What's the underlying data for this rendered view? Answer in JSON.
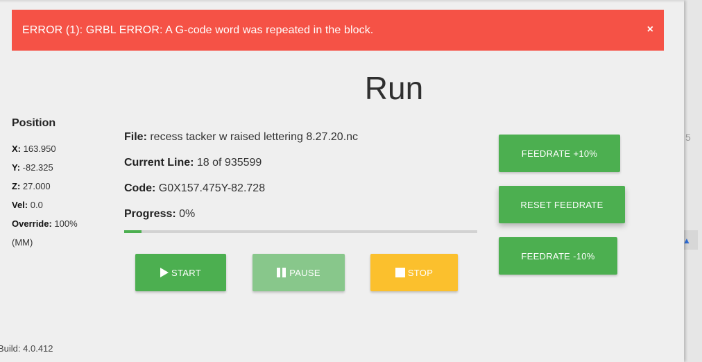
{
  "alert": {
    "message": "ERROR (1): GRBL ERROR: A G-code word was repeated in the block.",
    "close": "×",
    "color": "#f55246"
  },
  "page_title": "Run",
  "position": {
    "title": "Position",
    "x_label": "X:",
    "x_value": " 163.950",
    "y_label": "Y:",
    "y_value": " -82.325",
    "z_label": "Z:",
    "z_value": " 27.000",
    "vel_label": "Vel:",
    "vel_value": " 0.0",
    "override_label": "Override:",
    "override_value": " 100%",
    "units": "(MM)"
  },
  "job": {
    "file_label": "File:",
    "file_value": " recess tacker w raised lettering 8.27.20.nc",
    "line_label": "Current Line:",
    "line_value": " 18 of 935599",
    "code_label": "Code:",
    "code_value": " G0X157.475Y-82.728",
    "progress_label": "Progress:",
    "progress_value": " 0%",
    "progress_fraction": 0.05
  },
  "controls": {
    "start": "START",
    "pause": "PAUSE",
    "stop": "STOP"
  },
  "feedrate": {
    "up": "FEEDRATE +10%",
    "reset": "RESET FEEDRATE",
    "down": "FEEDRATE -10%"
  },
  "build": "Build: 4.0.412",
  "right_strip_num": "5",
  "colors": {
    "green": "#4caf50",
    "pause": "#88c78b",
    "stop": "#fbc02d"
  }
}
